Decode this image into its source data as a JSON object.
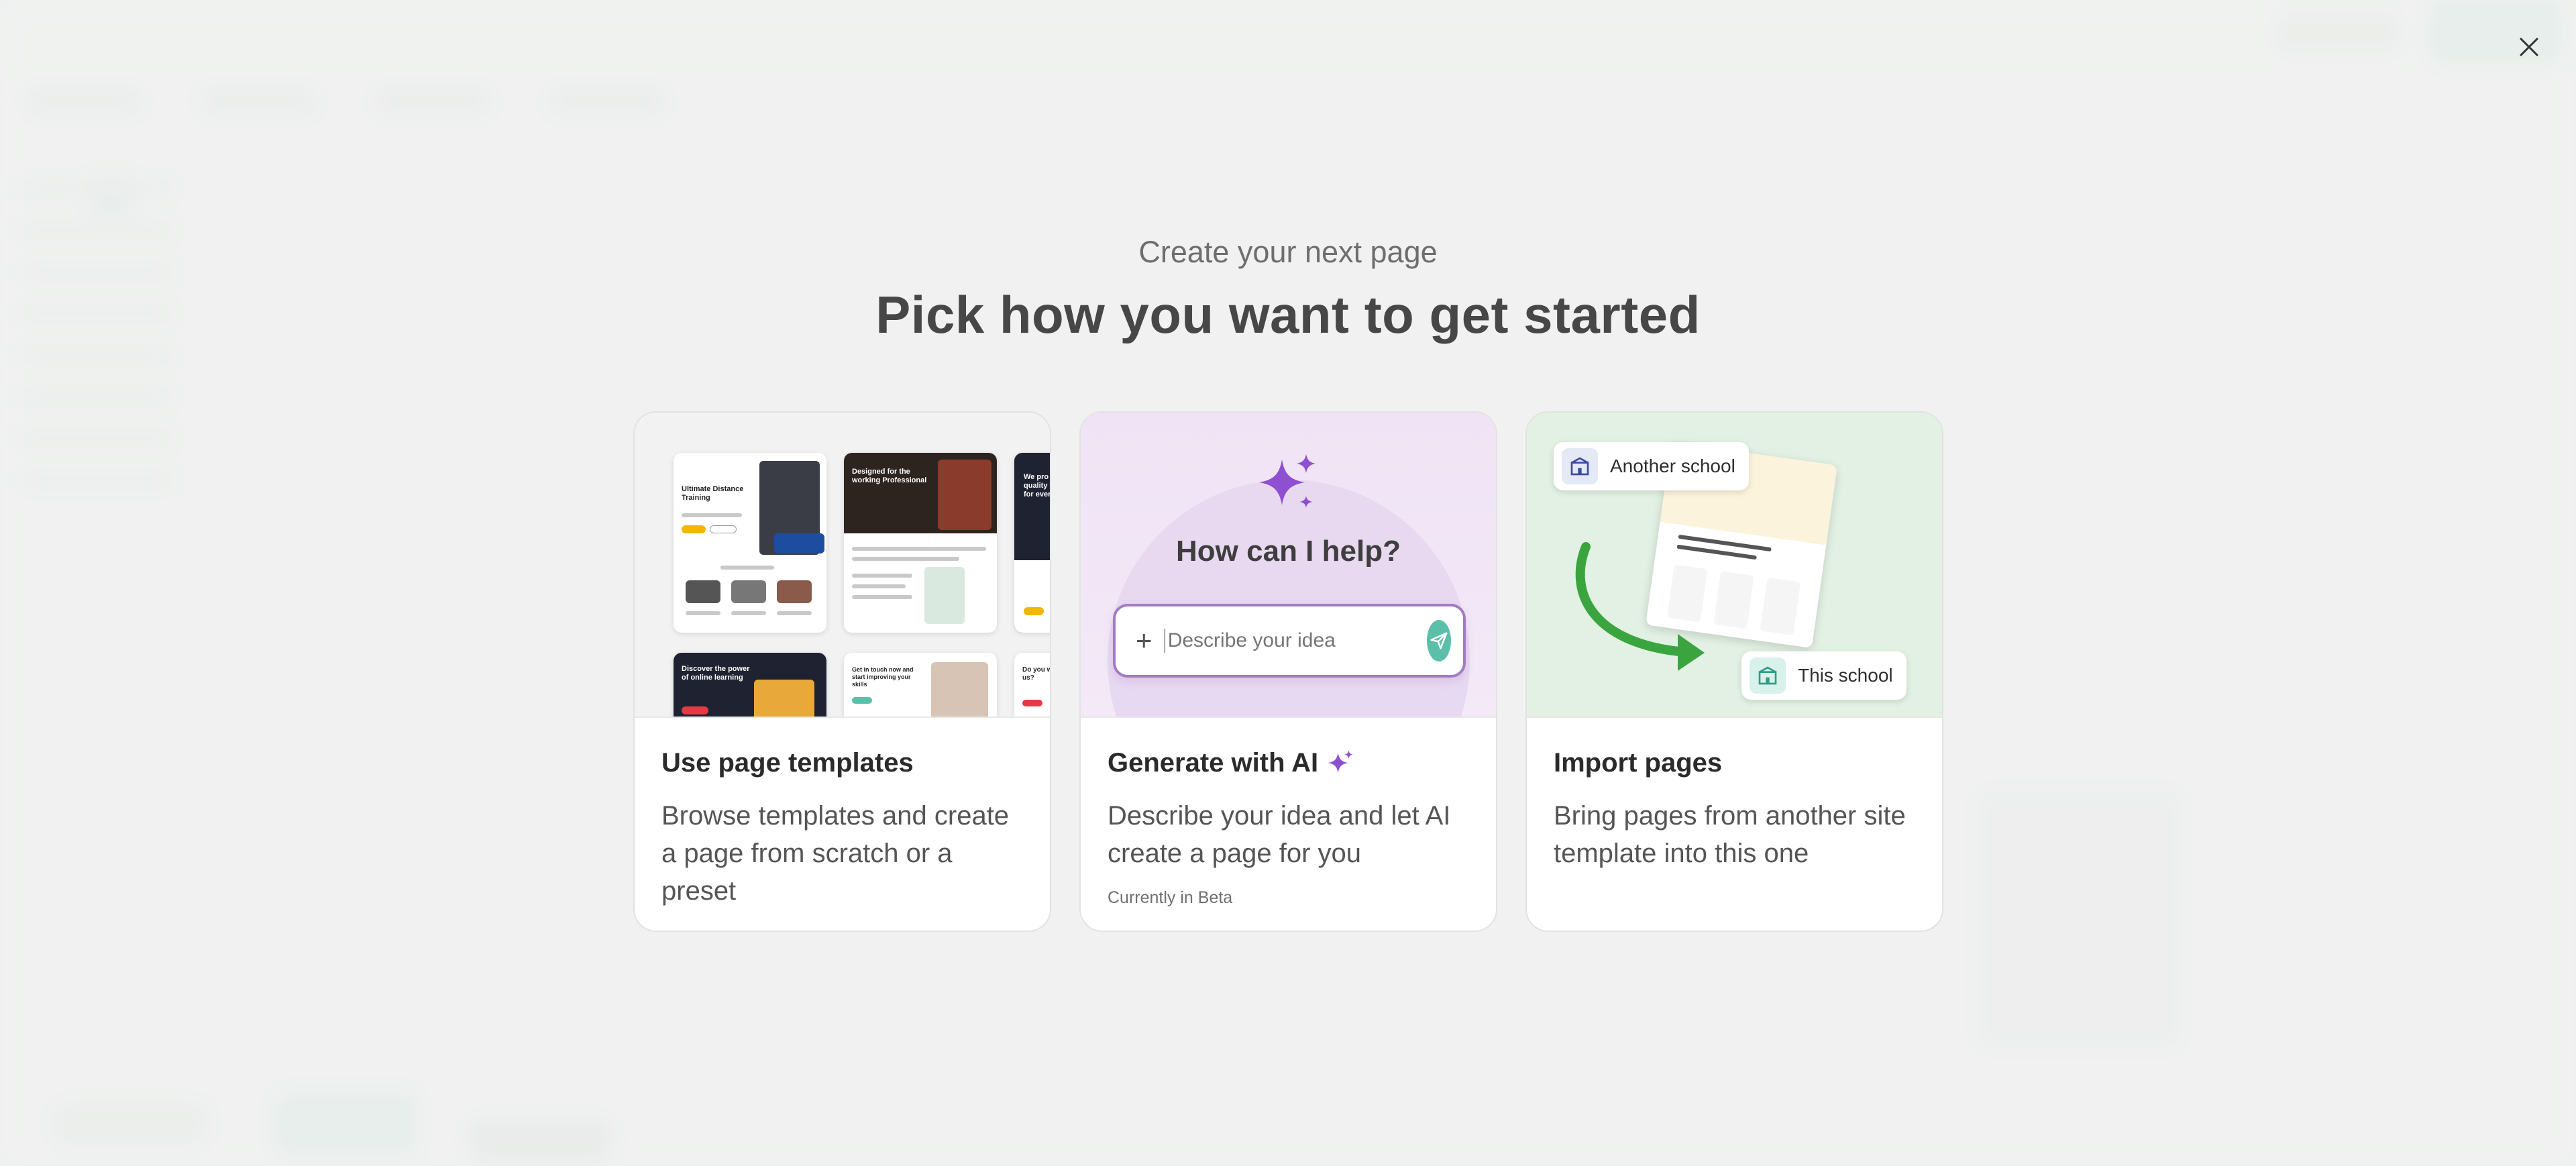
{
  "modal": {
    "subtitle": "Create your next page",
    "title": "Pick how you want to get started",
    "close_icon": "close-icon"
  },
  "cards": [
    {
      "title": "Use page templates",
      "description": "Browse templates and create a page from scratch or a preset",
      "preview": {
        "thumb1_title": "Ultimate Distance Training",
        "thumb2_title": "Designed for the working Professional",
        "thumb3_title": "We pro quality to for every",
        "thumb4_title": "Discover the power of online learning",
        "thumb5_title": "Get in touch now and start improving your skills",
        "thumb6_title": "Do you with us?"
      }
    },
    {
      "title": "Generate with AI",
      "title_icon": "sparkle-icon",
      "description": "Describe your idea and let AI create a page for you",
      "note": "Currently in Beta",
      "preview": {
        "question": "How can I help?",
        "input_placeholder": "Describe your idea",
        "plus_icon": "plus-icon",
        "send_icon": "send-icon"
      }
    },
    {
      "title": "Import pages",
      "description": "Bring pages from another site template into this one",
      "preview": {
        "source_label": "Another school",
        "target_label": "This school",
        "icon": "school-building-icon"
      }
    }
  ],
  "colors": {
    "accent_green": "#5cbfaa",
    "ai_purple": "#8e4fd1",
    "import_green": "#3aa53f"
  }
}
